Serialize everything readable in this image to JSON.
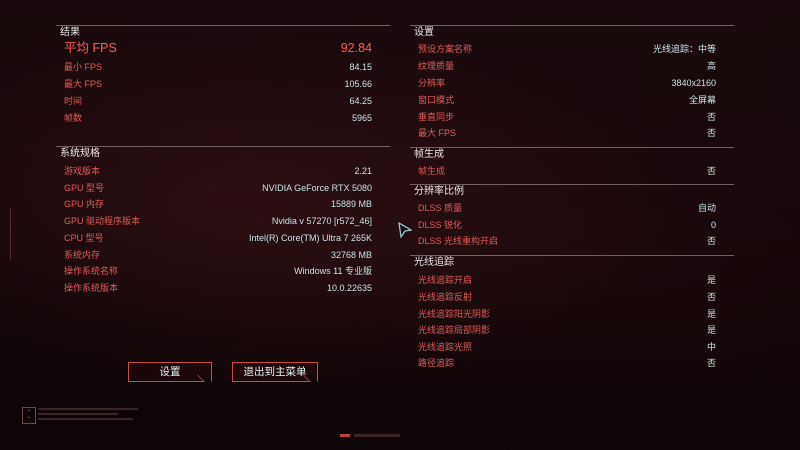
{
  "results": {
    "header": "结果",
    "avg_fps": {
      "label": "平均 FPS",
      "value": "92.84"
    },
    "rows": [
      {
        "label": "最小 FPS",
        "value": "84.15"
      },
      {
        "label": "最大 FPS",
        "value": "105.66"
      },
      {
        "label": "时间",
        "value": "64.25"
      },
      {
        "label": "帧数",
        "value": "5965"
      }
    ]
  },
  "system": {
    "header": "系统规格",
    "rows": [
      {
        "label": "游戏版本",
        "value": "2.21"
      },
      {
        "label": "GPU 型号",
        "value": "NVIDIA GeForce RTX 5080"
      },
      {
        "label": "GPU 内存",
        "value": "15889 MB"
      },
      {
        "label": "GPU 驱动程序版本",
        "value": "Nvidia v 57270 [r572_46]"
      },
      {
        "label": "CPU 型号",
        "value": "Intel(R) Core(TM) Ultra 7 265K"
      },
      {
        "label": "系统内存",
        "value": "32768 MB"
      },
      {
        "label": "操作系统名称",
        "value": "Windows 11 专业版"
      },
      {
        "label": "操作系统版本",
        "value": "10.0.22635"
      }
    ]
  },
  "settings": {
    "header": "设置",
    "rows": [
      {
        "label": "预设方案名称",
        "value": "光线追踪：中等"
      },
      {
        "label": "纹理质量",
        "value": "高"
      },
      {
        "label": "分辨率",
        "value": "3840x2160"
      },
      {
        "label": "窗口模式",
        "value": "全屏幕"
      },
      {
        "label": "垂直同步",
        "value": "否"
      },
      {
        "label": "最大 FPS",
        "value": "否"
      }
    ]
  },
  "frame_gen": {
    "header": "帧生成",
    "rows": [
      {
        "label": "帧生成",
        "value": "否"
      }
    ]
  },
  "resolution_scaling": {
    "header": "分辨率比例",
    "rows": [
      {
        "label": "DLSS 质量",
        "value": "自动"
      },
      {
        "label": "DLSS 锐化",
        "value": "0"
      },
      {
        "label": "DLSS 光线重构开启",
        "value": "否"
      }
    ]
  },
  "ray_tracing": {
    "header": "光线追踪",
    "rows": [
      {
        "label": "光线追踪开启",
        "value": "是"
      },
      {
        "label": "光线追踪反射",
        "value": "否"
      },
      {
        "label": "光线追踪阳光阴影",
        "value": "是"
      },
      {
        "label": "光线追踪局部阴影",
        "value": "是"
      },
      {
        "label": "光线追踪光照",
        "value": "中"
      },
      {
        "label": "路径追踪",
        "value": "否"
      }
    ]
  },
  "buttons": {
    "settings": "设置",
    "exit_main_menu": "退出到主菜单"
  },
  "colors": {
    "accent_red": "#e05a5a",
    "value_cyan": "#c9e3e6",
    "fps_red": "#ff5a5a"
  }
}
